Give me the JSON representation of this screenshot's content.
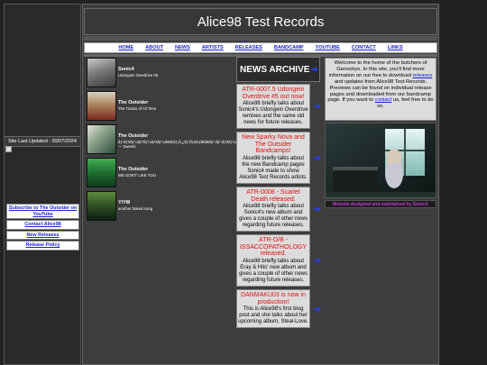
{
  "title": "Alice98 Test Records",
  "nav": [
    "HOME",
    "ABOUT",
    "NEWS",
    "ARTISTS",
    "RELEASES",
    "BANDCAMP",
    "YOUTUBE",
    "CONTACT",
    "LINKS"
  ],
  "sidebar": {
    "updated": "Site Last Updated : 30/07/2024",
    "links": [
      "Subscribe to The Outsider on YouTube",
      "Contact Alice98",
      "New Releases",
      "Release Policy"
    ]
  },
  "releases": [
    {
      "title": "Sonic4",
      "subtitle": "Udongein Overdrive #5",
      "cover_color": "#8a8a8a"
    },
    {
      "title": "The Outsider",
      "subtitle": "The Tracks of All Time",
      "cover_color": "#6a3b2c"
    },
    {
      "title": "The Outsider",
      "subtitle": "ãƒ‹ãƒ¥ãƒ¼ãƒªãƒ¼ãƒ€ãƒ¼ã€Œãƒ¡ã‚¿ãƒ‡ã‚£ã‚¢ã€ã€ãƒ»ãƒ‹ãƒ¥ãƒ¼ã‚¿ã‚¤ãƒ— Sweets",
      "cover_color": "#3d5c45"
    },
    {
      "title": "The Outsider",
      "subtitle": "WE DON'T LIKE YOU",
      "cover_color": "#1f5d2e"
    },
    {
      "title": "Y/YM",
      "subtitle": "another baked song",
      "cover_color": "#2b4d28"
    }
  ],
  "news_header": "NEWS ARCHIVE",
  "news": [
    {
      "title": "ATR-0007.5 Udongein Overdrive #5 out now!",
      "body": "Alice98 briefly talks about Sonic4's Udongein Overdrive remixes and the same old news for future releases."
    },
    {
      "title": "New Sparky Nova and The Outsider Bandcamps!",
      "body": "Alice98 briefly talks about the new Bandcamp pages Sonic4 made to show Alice98 Test Records artists."
    },
    {
      "title": "ATR-0008 - Scarlet Death released.",
      "body": "Alice98 briefly talks about Sonic4's new album and gives a couple of other news regarding future releases."
    },
    {
      "title": "ATR-O/B - ISSACCOPATHOLOGY released.",
      "body": "Alice98 briefly talks about Eray & Hits' new album and gives a couple of other news regarding future releases."
    },
    {
      "title": "DANMAKU03 is now in production!",
      "body": "This is Alice98's first blog post and she talks about her upcoming album, Steal-Love."
    }
  ],
  "welcome": {
    "part1": "Welcome to the home of the butchers of Gensokyo. In this site, you'll find more information on our free to download ",
    "link1": "releases",
    "part2": " and updates from Alice98 Test Records. Previews can be found on individual release pages and downloaded from our bandcamp page. If you want to ",
    "link2": "contact",
    "part3": " us, feel free to do so."
  },
  "credit": "Website designed and maintained by Sonic4."
}
